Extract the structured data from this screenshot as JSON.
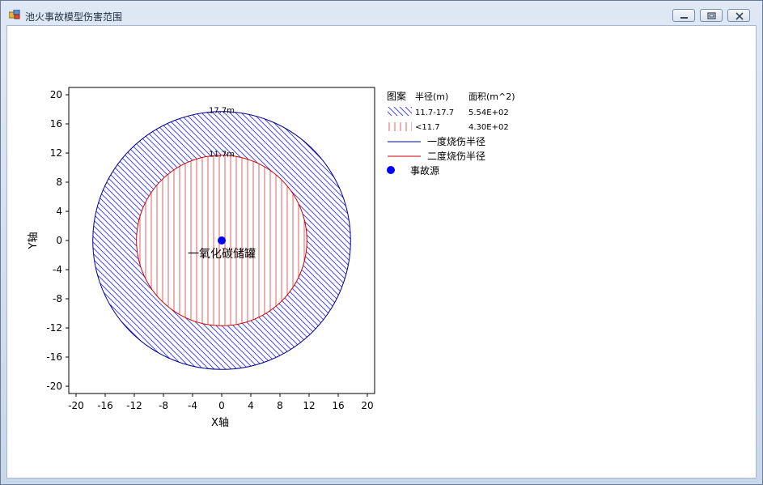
{
  "window": {
    "title": "池火事故模型伤害范围"
  },
  "chart_data": {
    "type": "scatter",
    "xlabel": "X轴",
    "ylabel": "Y轴",
    "xlim": [
      -21,
      21
    ],
    "ylim": [
      -21,
      21
    ],
    "x_ticks": [
      -20,
      -16,
      -12,
      -8,
      -4,
      0,
      4,
      8,
      12,
      16,
      20
    ],
    "y_ticks": [
      20,
      16,
      12,
      8,
      4,
      0,
      -4,
      -8,
      -12,
      -16,
      -20
    ],
    "circles": [
      {
        "name": "一度烧伤半径",
        "radius": 17.7,
        "label": "17.7m",
        "color": "#00008b"
      },
      {
        "name": "二度烧伤半径",
        "radius": 11.7,
        "label": "11.7m",
        "color": "#cc0000"
      }
    ],
    "source": {
      "name": "事故源",
      "x": 0,
      "y": 0,
      "label": "一氧化碳储罐",
      "color": "#0000ff"
    },
    "legend": {
      "header": {
        "pattern": "图案",
        "radius": "半径(m)",
        "area": "面积(m^2)"
      },
      "rows": [
        {
          "range": "11.7-17.7",
          "area": "5.54E+02",
          "color": "#4b4bdc"
        },
        {
          "range": "<11.7",
          "area": "4.30E+02",
          "color": "#e06060"
        }
      ],
      "lines": [
        {
          "label": "一度烧伤半径",
          "color": "#00008b"
        },
        {
          "label": "二度烧伤半径",
          "color": "#cc0000"
        }
      ],
      "marker_label": "事故源",
      "placement": "right"
    }
  }
}
